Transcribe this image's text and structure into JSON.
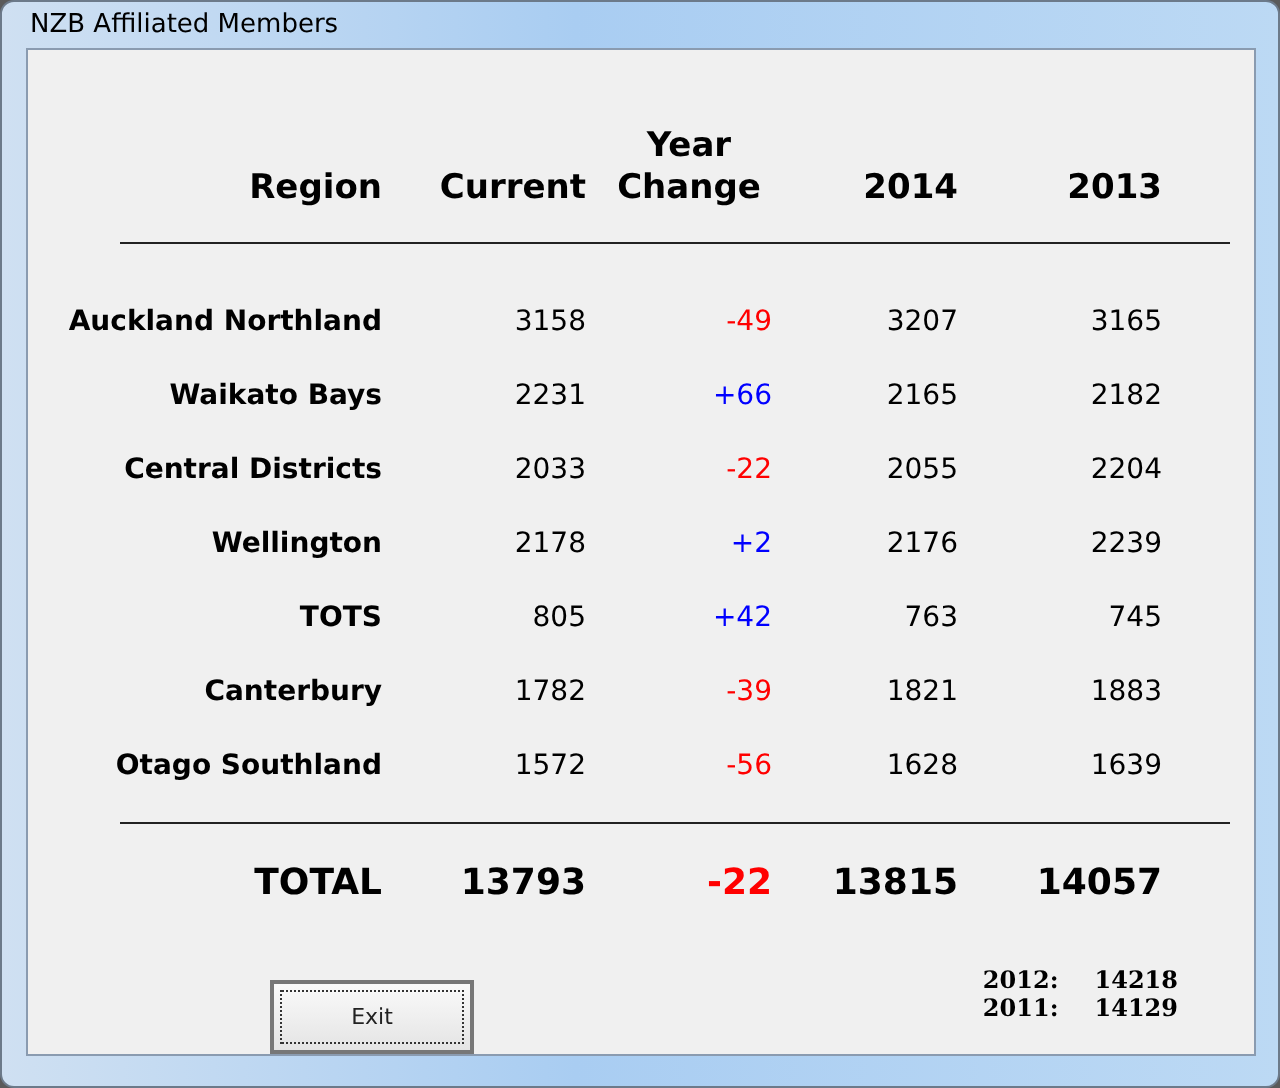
{
  "window": {
    "title": "NZB Affiliated Members"
  },
  "columns": [
    {
      "label": "Region"
    },
    {
      "label": "Current"
    },
    {
      "label": "Year Change"
    },
    {
      "label": "2014"
    },
    {
      "label": "2013"
    }
  ],
  "rows": [
    {
      "region": "Auckland Northland",
      "current": "3158",
      "change": "-49",
      "color": "#ff0000",
      "y2014": "3207",
      "y2013": "3165"
    },
    {
      "region": "Waikato Bays",
      "current": "2231",
      "change": "+66",
      "color": "#0000ff",
      "y2014": "2165",
      "y2013": "2182"
    },
    {
      "region": "Central Districts",
      "current": "2033",
      "change": "-22",
      "color": "#ff0000",
      "y2014": "2055",
      "y2013": "2204"
    },
    {
      "region": "Wellington",
      "current": "2178",
      "change": "+2",
      "color": "#0000ff",
      "y2014": "2176",
      "y2013": "2239"
    },
    {
      "region": "TOTS",
      "current": "805",
      "change": "+42",
      "color": "#0000ff",
      "y2014": "763",
      "y2013": "745"
    },
    {
      "region": "Canterbury",
      "current": "1782",
      "change": "-39",
      "color": "#ff0000",
      "y2014": "1821",
      "y2013": "1883"
    },
    {
      "region": "Otago Southland",
      "current": "1572",
      "change": "-56",
      "color": "#ff0000",
      "y2014": "1628",
      "y2013": "1639"
    }
  ],
  "total": {
    "label": "TOTAL",
    "current": "13793",
    "change": "-22",
    "color": "#ff0000",
    "y2014": "13815",
    "y2013": "14057"
  },
  "exit_button": {
    "label": "Exit"
  },
  "history": [
    {
      "year": "2012:",
      "value": "14218"
    },
    {
      "year": "2011:",
      "value": "14129"
    }
  ]
}
